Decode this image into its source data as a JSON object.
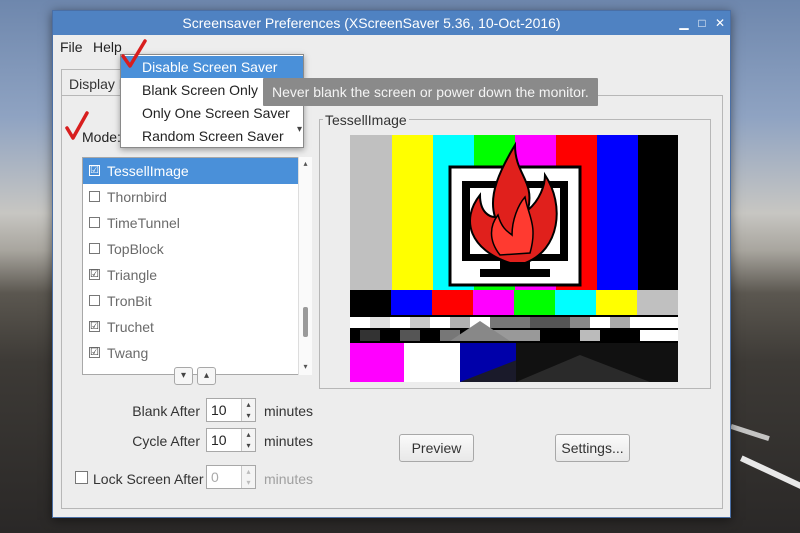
{
  "window": {
    "title": "Screensaver Preferences  (XScreenSaver 5.36, 10-Oct-2016)",
    "minimize_glyph": "▁",
    "maximize_glyph": "□",
    "close_glyph": "✕"
  },
  "menubar": {
    "file": "File",
    "help": "Help"
  },
  "tab": {
    "label": "Display Modes"
  },
  "mode": {
    "label": "Mode:",
    "options": [
      "Disable Screen Saver",
      "Blank Screen Only",
      "Only One Screen Saver",
      "Random Screen Saver"
    ],
    "highlighted": "Disable Screen Saver"
  },
  "tooltip": "Never blank the screen or power down the monitor.",
  "list": {
    "items": [
      {
        "label": "TessellImage",
        "checked": true,
        "selected": true
      },
      {
        "label": "Thornbird",
        "checked": false,
        "selected": false
      },
      {
        "label": "TimeTunnel",
        "checked": false,
        "selected": false
      },
      {
        "label": "TopBlock",
        "checked": false,
        "selected": false
      },
      {
        "label": "Triangle",
        "checked": true,
        "selected": false
      },
      {
        "label": "TronBit",
        "checked": false,
        "selected": false
      },
      {
        "label": "Truchet",
        "checked": true,
        "selected": false
      },
      {
        "label": "Twang",
        "checked": true,
        "selected": false
      }
    ]
  },
  "settings": {
    "blank_after": {
      "label": "Blank After",
      "value": "10",
      "unit": "minutes"
    },
    "cycle_after": {
      "label": "Cycle After",
      "value": "10",
      "unit": "minutes"
    },
    "lock_after": {
      "label": "Lock Screen After",
      "value": "0",
      "unit": "minutes",
      "enabled": false
    }
  },
  "preview": {
    "title": "TessellImage",
    "preview_button": "Preview",
    "settings_button": "Settings..."
  },
  "colors": {
    "accent": "#4a90d9",
    "titlebar": "#4f82c2",
    "tooltip": "#8a8a8a",
    "annotation_check": "#d81e1e"
  },
  "icons": {
    "checkbox_checked": "☑",
    "arrow_down": "▾",
    "arrow_up": "▴"
  }
}
